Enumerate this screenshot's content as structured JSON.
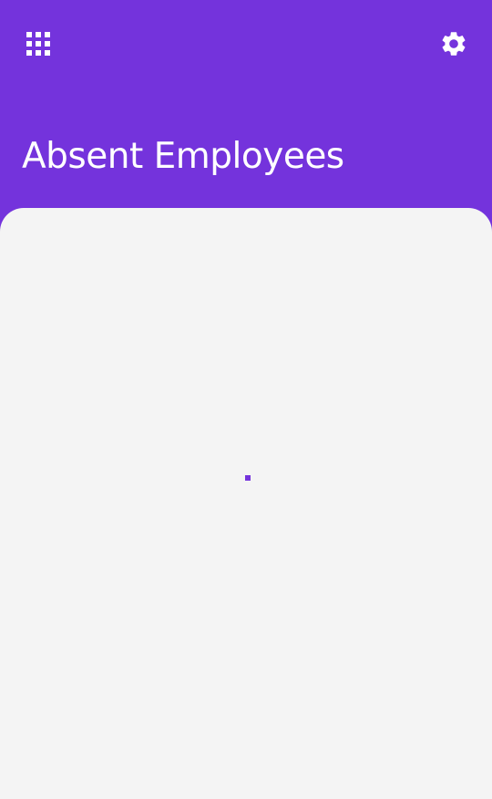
{
  "header": {
    "title": "Absent Employees",
    "apps_icon": "apps-grid-icon",
    "settings_icon": "gear-icon"
  },
  "content": {
    "state": "loading"
  },
  "colors": {
    "primary": "#7433dc",
    "background": "#f4f4f4",
    "on_primary": "#ffffff"
  }
}
